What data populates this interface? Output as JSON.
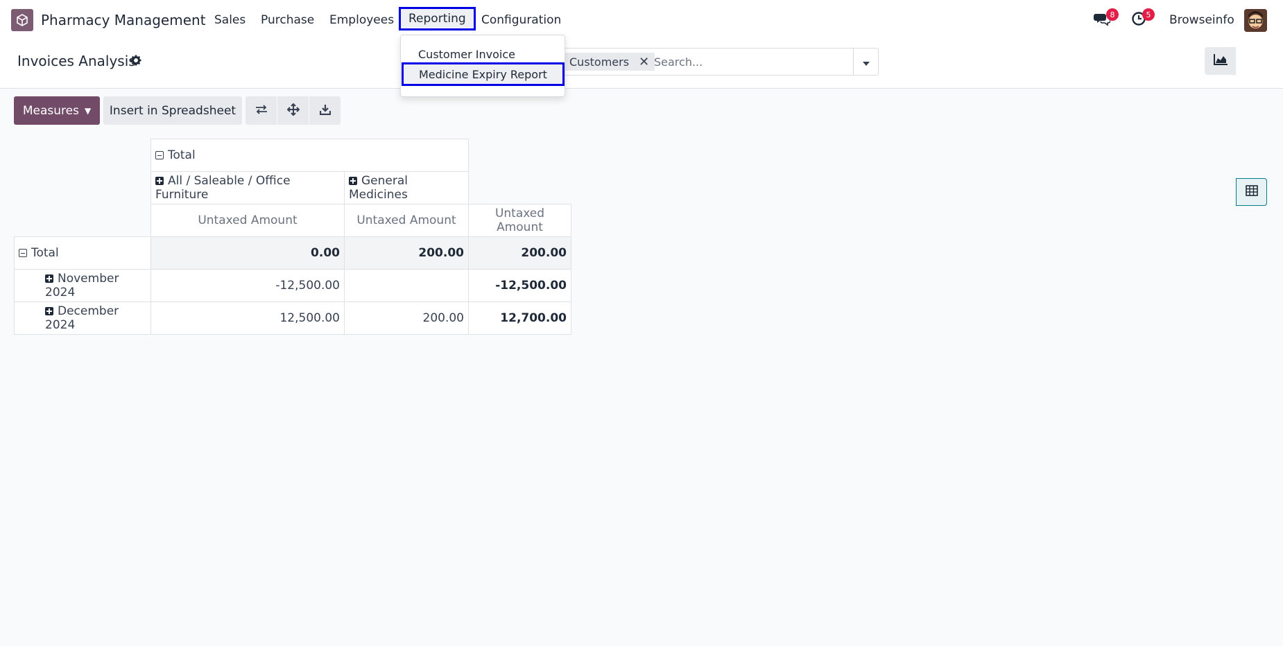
{
  "navbar": {
    "app_name": "Pharmacy Management",
    "menu": [
      "Sales",
      "Purchase",
      "Employees",
      "Reporting",
      "Configuration"
    ],
    "messages_badge": "8",
    "activities_badge": "5",
    "user_name": "Browseinfo"
  },
  "reporting_dropdown": {
    "items": [
      "Customer Invoice",
      "Medicine Expiry Report"
    ]
  },
  "control_panel": {
    "title": "Invoices Analysis",
    "facet": "Customers",
    "search_placeholder": "Search..."
  },
  "toolbar": {
    "measures_label": "Measures",
    "spreadsheet_label": "Insert in Spreadsheet"
  },
  "pivot": {
    "col_total": "Total",
    "col_groups": [
      "All / Saleable / Office Furniture",
      "General Medicines"
    ],
    "measure": "Untaxed Amount",
    "rows": [
      {
        "label": "Total",
        "values": [
          "0.00",
          "200.00",
          "200.00"
        ]
      },
      {
        "label": "November 2024",
        "values": [
          "-12,500.00",
          "",
          "-12,500.00"
        ]
      },
      {
        "label": "December 2024",
        "values": [
          "12,500.00",
          "200.00",
          "12,700.00"
        ]
      }
    ]
  },
  "colors": {
    "brand": "#714b67",
    "highlight_border": "#0000e6",
    "badge": "#e11d48"
  },
  "icons": [
    "app-logo-icon",
    "chat-icon",
    "clock-icon",
    "gear-icon",
    "close-icon",
    "caret-down-icon",
    "area-chart-icon",
    "pivot-table-icon",
    "swap-axis-icon",
    "expand-all-icon",
    "download-icon",
    "minus-square-icon",
    "plus-square-icon"
  ]
}
